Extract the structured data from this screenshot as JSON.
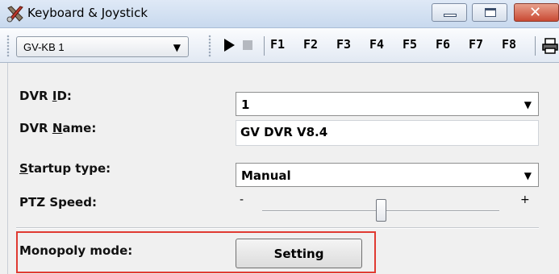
{
  "window": {
    "title": "Keyboard & Joystick",
    "icon": "wrench-tools-icon",
    "controls": [
      "minimize-icon",
      "maximize-icon",
      "close-icon"
    ]
  },
  "toolbar": {
    "keyboard_select": {
      "value": "GV-KB 1"
    },
    "icons": [
      "play-icon",
      "stop-icon",
      "print-icon"
    ],
    "function_keys": [
      "F1",
      "F2",
      "F3",
      "F4",
      "F5",
      "F6",
      "F7",
      "F8"
    ]
  },
  "form": {
    "dvr_id": {
      "label_prefix": "DVR ",
      "label_mnemonic": "I",
      "label_rest": "D:",
      "value": "1"
    },
    "dvr_name": {
      "label_prefix": "DVR ",
      "label_mnemonic": "N",
      "label_rest": "ame:",
      "value": "GV DVR V8.4"
    },
    "startup_type": {
      "label_prefix": "",
      "label_mnemonic": "S",
      "label_rest": "tartup type:",
      "value": "Manual"
    },
    "ptz_speed": {
      "label": "PTZ Speed:",
      "min_label": "-",
      "max_label": "+",
      "level": 0.5
    },
    "monopoly_mode": {
      "label": "Monopoly mode:",
      "button_label": "Setting"
    }
  },
  "colors": {
    "highlight_border": "#e03a32",
    "close_button": "#c94a33"
  }
}
